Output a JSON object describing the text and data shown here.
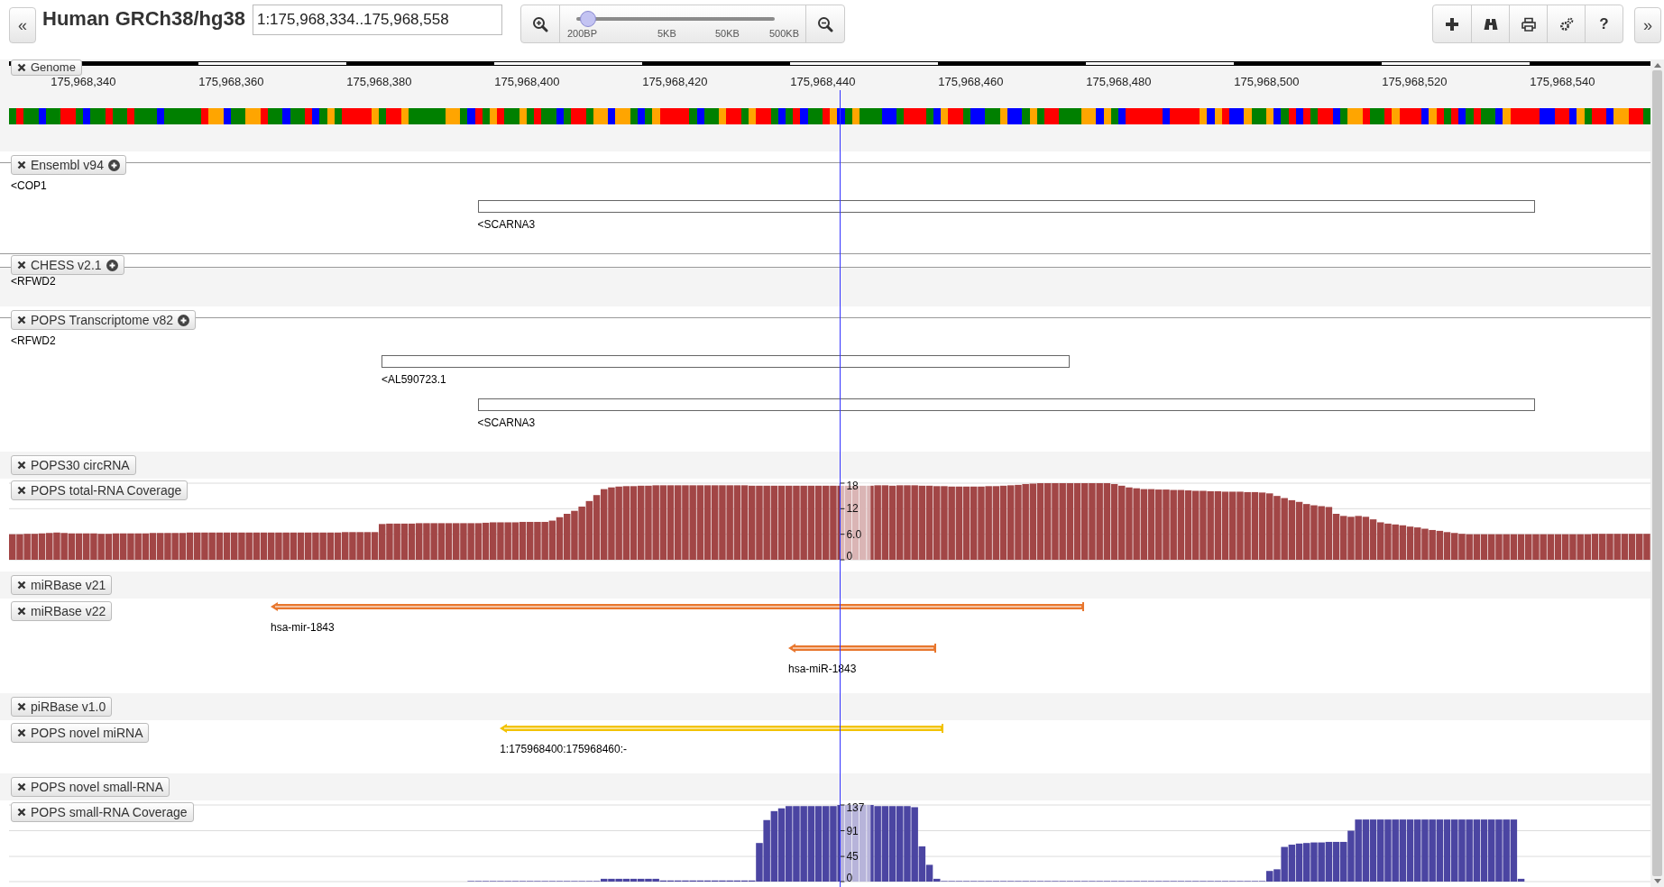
{
  "header": {
    "left_button": "«",
    "title": "Human GRCh38/hg38",
    "location": "1:175,968,334..175,968,558",
    "zoom": {
      "level": 0.06,
      "labels": [
        "200BP",
        "5KB",
        "50KB",
        "500KB"
      ]
    },
    "tools": [
      {
        "kind": "add"
      },
      {
        "kind": "binoculars"
      },
      {
        "kind": "print"
      },
      {
        "kind": "gears"
      },
      {
        "kind": "help",
        "label": "?"
      }
    ],
    "right_button": "»"
  },
  "tracks": [
    {
      "kind": "reference",
      "label": "Genome",
      "menu": false,
      "ruler_labels": [
        "175,968,340",
        "175,968,360",
        "175,968,380",
        "175,968,400",
        "175,968,420",
        "175,968,440",
        "175,968,460",
        "175,968,480",
        "175,968,500",
        "175,968,520",
        "175,968,540"
      ]
    },
    {
      "kind": "features",
      "label": "Ensembl v94",
      "menu": true,
      "ruled": true,
      "shaded": false,
      "features": [
        {
          "kind": "label",
          "label": "<COP1"
        },
        {
          "kind": "box",
          "label": "<SCARNA3"
        }
      ]
    },
    {
      "kind": "features",
      "label": "CHESS v2.1",
      "menu": true,
      "ruled": true,
      "shaded": true,
      "features": [
        {
          "kind": "label",
          "label": "<RFWD2"
        }
      ]
    },
    {
      "kind": "features",
      "label": "POPS Transcriptome v82",
      "menu": true,
      "ruled": true,
      "shaded": false,
      "features": [
        {
          "kind": "label",
          "label": "<RFWD2"
        },
        {
          "kind": "box",
          "label": "<AL590723.1"
        },
        {
          "kind": "box",
          "label": "<SCARNA3"
        }
      ]
    },
    {
      "kind": "empty",
      "label": "POPS30 circRNA",
      "menu": false
    },
    {
      "kind": "coverage",
      "label": "POPS total-RNA Coverage",
      "menu": false,
      "chart_data": {
        "type": "bar",
        "ylim": [
          0,
          18
        ],
        "yticks": [
          0,
          {
            "value": 6,
            "label": "6.0"
          },
          12,
          18
        ],
        "series": [
          {
            "color": "#a24646",
            "values": [
              6.0,
              6.0,
              6.1,
              6.1,
              6.2,
              6.3,
              6.4,
              6.3,
              6.2,
              6.2,
              6.2,
              6.2,
              6.1,
              6.1,
              6.2,
              6.2,
              6.2,
              6.2,
              6.2,
              6.3,
              6.3,
              6.3,
              6.3,
              6.3,
              6.4,
              6.4,
              6.4,
              6.4,
              6.4,
              6.4,
              6.4,
              6.4,
              6.4,
              6.4,
              6.4,
              6.4,
              6.4,
              6.4,
              6.4,
              6.4,
              6.4,
              6.4,
              6.4,
              6.4,
              6.4,
              6.5,
              6.5,
              6.5,
              6.5,
              6.5,
              8.4,
              8.5,
              8.5,
              8.5,
              8.5,
              8.6,
              8.6,
              8.6,
              8.6,
              8.6,
              8.6,
              8.6,
              8.6,
              8.6,
              8.7,
              8.8,
              8.8,
              8.8,
              8.8,
              8.9,
              8.9,
              8.9,
              8.9,
              9.2,
              10.0,
              10.8,
              11.5,
              12.5,
              13.8,
              15.2,
              16.6,
              17.0,
              17.2,
              17.3,
              17.3,
              17.4,
              17.4,
              17.5,
              17.5,
              17.5,
              17.5,
              17.5,
              17.5,
              17.5,
              17.5,
              17.5,
              17.5,
              17.5,
              17.5,
              17.5,
              17.4,
              17.4,
              17.4,
              17.4,
              17.4,
              17.4,
              17.4,
              17.4,
              17.4,
              17.4,
              17.4,
              17.4,
              17.4,
              17.4,
              17.4,
              17.4,
              17.4,
              17.5,
              17.5,
              17.4,
              17.5,
              17.5,
              17.5,
              17.4,
              17.4,
              17.3,
              17.3,
              17.2,
              17.2,
              17.2,
              17.2,
              17.2,
              17.3,
              17.3,
              17.4,
              17.5,
              17.6,
              17.8,
              17.9,
              18.0,
              18.0,
              18.0,
              18.0,
              18.0,
              18.0,
              18.0,
              18.0,
              18.0,
              18.0,
              17.8,
              17.4,
              17.0,
              16.8,
              16.6,
              16.6,
              16.5,
              16.5,
              16.4,
              16.4,
              16.3,
              16.2,
              16.2,
              16.1,
              16.1,
              16.0,
              16.0,
              16.0,
              15.9,
              15.9,
              15.8,
              15.6,
              15.0,
              14.5,
              14.0,
              13.6,
              13.1,
              12.8,
              12.6,
              12.4,
              10.8,
              10.3,
              10.1,
              10.3,
              10.1,
              9.5,
              8.8,
              8.5,
              8.3,
              8.1,
              7.8,
              7.6,
              7.3,
              7.0,
              6.8,
              6.5,
              6.3,
              6.1,
              6.0,
              6.0,
              6.0,
              6.0,
              6.0,
              6.0,
              6.0,
              6.0,
              6.0,
              6.0,
              6.0,
              6.0,
              6.0,
              6.0,
              6.0,
              6.0,
              6.0,
              6.1,
              6.1,
              6.1,
              6.1,
              6.1,
              6.1,
              6.1,
              6.1
            ]
          }
        ]
      }
    },
    {
      "kind": "empty",
      "label": "miRBase v21",
      "menu": false
    },
    {
      "kind": "features",
      "label": "miRBase v22",
      "menu": false,
      "features": [
        {
          "kind": "arrow",
          "label": "hsa-mir-1843",
          "color": "#e8772e"
        },
        {
          "kind": "arrow",
          "label": "hsa-miR-1843",
          "color": "#e8772e"
        }
      ]
    },
    {
      "kind": "empty",
      "label": "piRBase v1.0",
      "menu": false
    },
    {
      "kind": "features",
      "label": "POPS novel miRNA",
      "menu": false,
      "features": [
        {
          "kind": "arrow",
          "label": "1:175968400:175968460:-",
          "color": "#f2c200"
        }
      ]
    },
    {
      "kind": "empty",
      "label": "POPS novel small-RNA",
      "menu": false
    },
    {
      "kind": "coverage",
      "label": "POPS small-RNA Coverage",
      "menu": false,
      "chart_data": {
        "type": "bar",
        "ylim": [
          0,
          137
        ],
        "yticks": [
          0,
          45,
          91,
          137
        ],
        "series": [
          {
            "color": "#4b45a2",
            "values": [
              0,
              0,
              0,
              0,
              0,
              0,
              0,
              0,
              0,
              0,
              0,
              0,
              0,
              0,
              0,
              0,
              0,
              0,
              0,
              0,
              0,
              0,
              0,
              0,
              0,
              0,
              0,
              0,
              0,
              0,
              0,
              0,
              0,
              0,
              0,
              0,
              0,
              0,
              0,
              0,
              0,
              0,
              0,
              0,
              0,
              0,
              0,
              0,
              0,
              0,
              0,
              0,
              0,
              0,
              0,
              0,
              0,
              0,
              0,
              0,
              0,
              0,
              1,
              1,
              1,
              1,
              1,
              1,
              1,
              1,
              1,
              1,
              1,
              1,
              1,
              1,
              1,
              1,
              1,
              1,
              5,
              5,
              5,
              5,
              5,
              5,
              5,
              5,
              2,
              2,
              2,
              2,
              2,
              2,
              2,
              2,
              2,
              2,
              2,
              2,
              2,
              69,
              110,
              126,
              131,
              135,
              135,
              135,
              135,
              135,
              135,
              135,
              137,
              137,
              137,
              137,
              137,
              135,
              135,
              135,
              135,
              135,
              133,
              63,
              30,
              5,
              1,
              1,
              1,
              1,
              1,
              1,
              1,
              1,
              1,
              1,
              1,
              1,
              1,
              1,
              1,
              1,
              1,
              1,
              1,
              1,
              1,
              1,
              1,
              1,
              1,
              1,
              1,
              1,
              1,
              1,
              1,
              1,
              1,
              1,
              1,
              1,
              1,
              1,
              1,
              1,
              1,
              1,
              1,
              1,
              19,
              22,
              62,
              66,
              68,
              69,
              70,
              70,
              71,
              71,
              71,
              91,
              111,
              111,
              111,
              111,
              111,
              111,
              111,
              111,
              111,
              111,
              111,
              111,
              111,
              111,
              111,
              111,
              111,
              111,
              111,
              111,
              111,
              111,
              5,
              0,
              0,
              0,
              0,
              0,
              0,
              0,
              0,
              0,
              0,
              0,
              0,
              0,
              0,
              0,
              0,
              0
            ]
          }
        ]
      }
    }
  ]
}
